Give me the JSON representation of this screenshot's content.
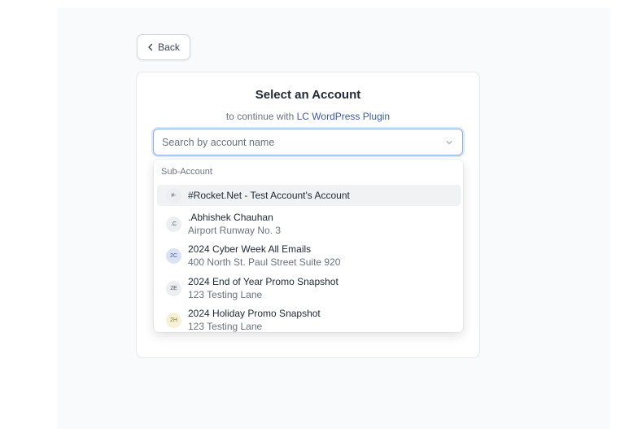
{
  "back_button": {
    "label": "Back"
  },
  "card": {
    "title": "Select an Account",
    "subtitle_prefix": "to continue with ",
    "subtitle_link": "LC WordPress Plugin"
  },
  "search": {
    "placeholder": "Search by account name",
    "value": ""
  },
  "dropdown": {
    "group_label": "Sub-Account",
    "items": [
      {
        "initials": "#-",
        "name": "#Rocket.Net - Test Account's Account",
        "address": "",
        "avatar_bg": "#eceef1",
        "avatar_fg": "#4b5563"
      },
      {
        "initials": ".C",
        "name": ".Abhishek Chauhan",
        "address": "Airport Runway No. 3",
        "avatar_bg": "#eceef1",
        "avatar_fg": "#4b5563"
      },
      {
        "initials": "2C",
        "name": "2024 Cyber Week All Emails",
        "address": "400 North St. Paul Street Suite 920",
        "avatar_bg": "#dbe3f5",
        "avatar_fg": "#3b5ba9"
      },
      {
        "initials": "2E",
        "name": "2024 End of Year Promo Snapshot",
        "address": "123 Testing Lane",
        "avatar_bg": "#eceef1",
        "avatar_fg": "#4b5563"
      },
      {
        "initials": "2H",
        "name": "2024 Holiday Promo Snapshot",
        "address": "123 Testing Lane",
        "avatar_bg": "#f6f1d8",
        "avatar_fg": "#8a7a2a"
      }
    ]
  },
  "colors": {
    "accent_link": "#3b5ba9",
    "focus_border": "#93aede",
    "active_row": "#f1f2f4"
  },
  "icons": {
    "back": "chevron-left-icon",
    "dropdown": "chevron-down-icon"
  }
}
